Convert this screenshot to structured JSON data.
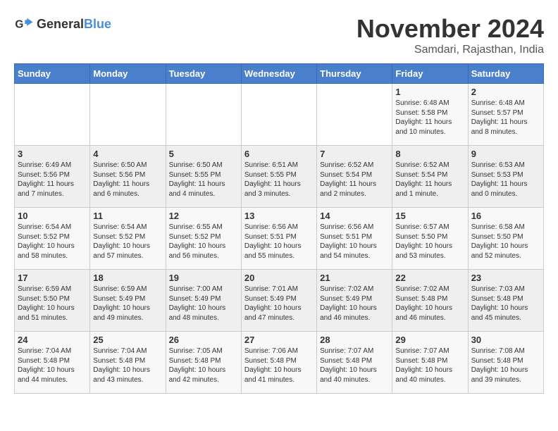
{
  "logo": {
    "general": "General",
    "blue": "Blue"
  },
  "header": {
    "month": "November 2024",
    "location": "Samdari, Rajasthan, India"
  },
  "weekdays": [
    "Sunday",
    "Monday",
    "Tuesday",
    "Wednesday",
    "Thursday",
    "Friday",
    "Saturday"
  ],
  "weeks": [
    [
      {
        "day": "",
        "info": ""
      },
      {
        "day": "",
        "info": ""
      },
      {
        "day": "",
        "info": ""
      },
      {
        "day": "",
        "info": ""
      },
      {
        "day": "",
        "info": ""
      },
      {
        "day": "1",
        "info": "Sunrise: 6:48 AM\nSunset: 5:58 PM\nDaylight: 11 hours and 10 minutes."
      },
      {
        "day": "2",
        "info": "Sunrise: 6:48 AM\nSunset: 5:57 PM\nDaylight: 11 hours and 8 minutes."
      }
    ],
    [
      {
        "day": "3",
        "info": "Sunrise: 6:49 AM\nSunset: 5:56 PM\nDaylight: 11 hours and 7 minutes."
      },
      {
        "day": "4",
        "info": "Sunrise: 6:50 AM\nSunset: 5:56 PM\nDaylight: 11 hours and 6 minutes."
      },
      {
        "day": "5",
        "info": "Sunrise: 6:50 AM\nSunset: 5:55 PM\nDaylight: 11 hours and 4 minutes."
      },
      {
        "day": "6",
        "info": "Sunrise: 6:51 AM\nSunset: 5:55 PM\nDaylight: 11 hours and 3 minutes."
      },
      {
        "day": "7",
        "info": "Sunrise: 6:52 AM\nSunset: 5:54 PM\nDaylight: 11 hours and 2 minutes."
      },
      {
        "day": "8",
        "info": "Sunrise: 6:52 AM\nSunset: 5:54 PM\nDaylight: 11 hours and 1 minute."
      },
      {
        "day": "9",
        "info": "Sunrise: 6:53 AM\nSunset: 5:53 PM\nDaylight: 11 hours and 0 minutes."
      }
    ],
    [
      {
        "day": "10",
        "info": "Sunrise: 6:54 AM\nSunset: 5:52 PM\nDaylight: 10 hours and 58 minutes."
      },
      {
        "day": "11",
        "info": "Sunrise: 6:54 AM\nSunset: 5:52 PM\nDaylight: 10 hours and 57 minutes."
      },
      {
        "day": "12",
        "info": "Sunrise: 6:55 AM\nSunset: 5:52 PM\nDaylight: 10 hours and 56 minutes."
      },
      {
        "day": "13",
        "info": "Sunrise: 6:56 AM\nSunset: 5:51 PM\nDaylight: 10 hours and 55 minutes."
      },
      {
        "day": "14",
        "info": "Sunrise: 6:56 AM\nSunset: 5:51 PM\nDaylight: 10 hours and 54 minutes."
      },
      {
        "day": "15",
        "info": "Sunrise: 6:57 AM\nSunset: 5:50 PM\nDaylight: 10 hours and 53 minutes."
      },
      {
        "day": "16",
        "info": "Sunrise: 6:58 AM\nSunset: 5:50 PM\nDaylight: 10 hours and 52 minutes."
      }
    ],
    [
      {
        "day": "17",
        "info": "Sunrise: 6:59 AM\nSunset: 5:50 PM\nDaylight: 10 hours and 51 minutes."
      },
      {
        "day": "18",
        "info": "Sunrise: 6:59 AM\nSunset: 5:49 PM\nDaylight: 10 hours and 49 minutes."
      },
      {
        "day": "19",
        "info": "Sunrise: 7:00 AM\nSunset: 5:49 PM\nDaylight: 10 hours and 48 minutes."
      },
      {
        "day": "20",
        "info": "Sunrise: 7:01 AM\nSunset: 5:49 PM\nDaylight: 10 hours and 47 minutes."
      },
      {
        "day": "21",
        "info": "Sunrise: 7:02 AM\nSunset: 5:49 PM\nDaylight: 10 hours and 46 minutes."
      },
      {
        "day": "22",
        "info": "Sunrise: 7:02 AM\nSunset: 5:48 PM\nDaylight: 10 hours and 46 minutes."
      },
      {
        "day": "23",
        "info": "Sunrise: 7:03 AM\nSunset: 5:48 PM\nDaylight: 10 hours and 45 minutes."
      }
    ],
    [
      {
        "day": "24",
        "info": "Sunrise: 7:04 AM\nSunset: 5:48 PM\nDaylight: 10 hours and 44 minutes."
      },
      {
        "day": "25",
        "info": "Sunrise: 7:04 AM\nSunset: 5:48 PM\nDaylight: 10 hours and 43 minutes."
      },
      {
        "day": "26",
        "info": "Sunrise: 7:05 AM\nSunset: 5:48 PM\nDaylight: 10 hours and 42 minutes."
      },
      {
        "day": "27",
        "info": "Sunrise: 7:06 AM\nSunset: 5:48 PM\nDaylight: 10 hours and 41 minutes."
      },
      {
        "day": "28",
        "info": "Sunrise: 7:07 AM\nSunset: 5:48 PM\nDaylight: 10 hours and 40 minutes."
      },
      {
        "day": "29",
        "info": "Sunrise: 7:07 AM\nSunset: 5:48 PM\nDaylight: 10 hours and 40 minutes."
      },
      {
        "day": "30",
        "info": "Sunrise: 7:08 AM\nSunset: 5:48 PM\nDaylight: 10 hours and 39 minutes."
      }
    ]
  ]
}
